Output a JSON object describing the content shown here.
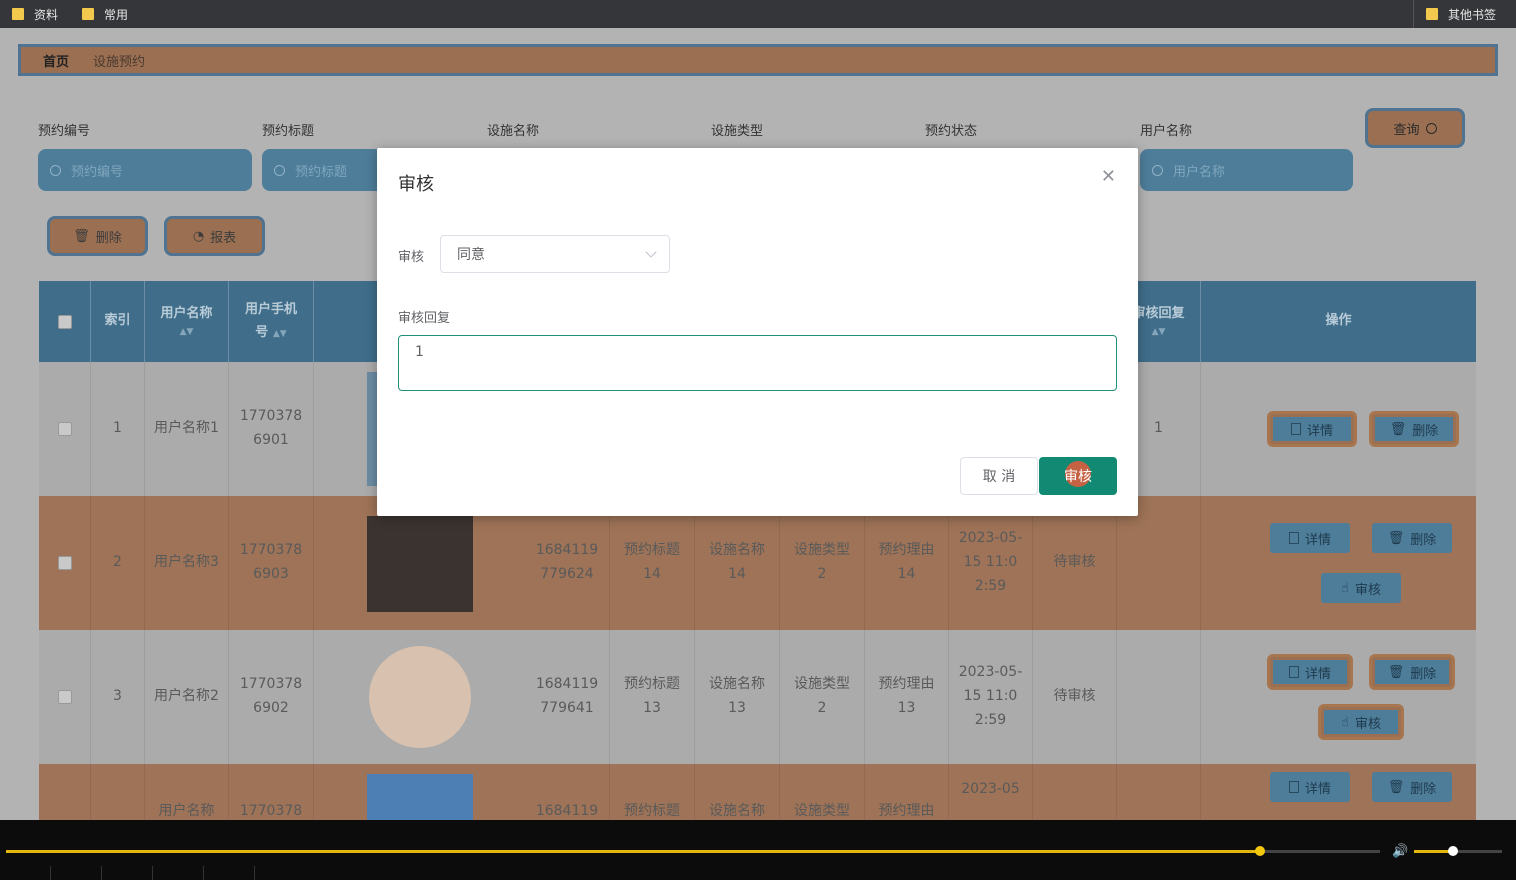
{
  "bookmarks": {
    "items": [
      "资料",
      "常用"
    ],
    "other": "其他书签"
  },
  "breadcrumb": {
    "home": "首页",
    "current": "设施预约"
  },
  "filters": {
    "labels": [
      "预约编号",
      "预约标题",
      "设施名称",
      "设施类型",
      "预约状态",
      "用户名称"
    ],
    "placeholders": [
      "预约编号",
      "预约标题",
      "用户名称"
    ],
    "query_label": "查询"
  },
  "toolbar": {
    "delete_label": "删除",
    "report_label": "报表"
  },
  "table": {
    "headers": {
      "index": "索引",
      "username": "用户名称",
      "phone": "用户手机号",
      "reply": "审核回复",
      "ops": "操作"
    },
    "rows": [
      {
        "index": "1",
        "username": "用户名称1",
        "phone": "17703786901",
        "booking_no": "",
        "title": "",
        "facility": "",
        "type": "",
        "reason": "",
        "time": "",
        "status": "",
        "reply": "1"
      },
      {
        "index": "2",
        "username": "用户名称3",
        "phone": "17703786903",
        "booking_no": "1684119779624",
        "title": "预约标题14",
        "facility": "设施名称14",
        "type": "设施类型2",
        "reason": "预约理由14",
        "time": "2023-05-15 11:02:59",
        "status": "待审核",
        "reply": ""
      },
      {
        "index": "3",
        "username": "用户名称2",
        "phone": "17703786902",
        "booking_no": "1684119779641",
        "title": "预约标题13",
        "facility": "设施名称13",
        "type": "设施类型2",
        "reason": "预约理由13",
        "time": "2023-05-15 11:02:59",
        "status": "待审核",
        "reply": ""
      },
      {
        "index": "",
        "username": "用户名称",
        "phone": "1770378",
        "booking_no": "1684119",
        "title": "预约标题",
        "facility": "设施名称",
        "type": "设施类型",
        "reason": "预约理由",
        "time": "2023-05",
        "status": "",
        "reply": ""
      }
    ],
    "ops": {
      "detail": "详情",
      "delete": "删除",
      "audit": "审核"
    }
  },
  "modal": {
    "title": "审核",
    "audit_label": "审核",
    "audit_value": "同意",
    "reply_label": "审核回复",
    "reply_value": "1",
    "cancel_label": "取 消",
    "ok_label": "审核"
  },
  "player": {
    "progress": 0.83,
    "volume": 0.45
  }
}
